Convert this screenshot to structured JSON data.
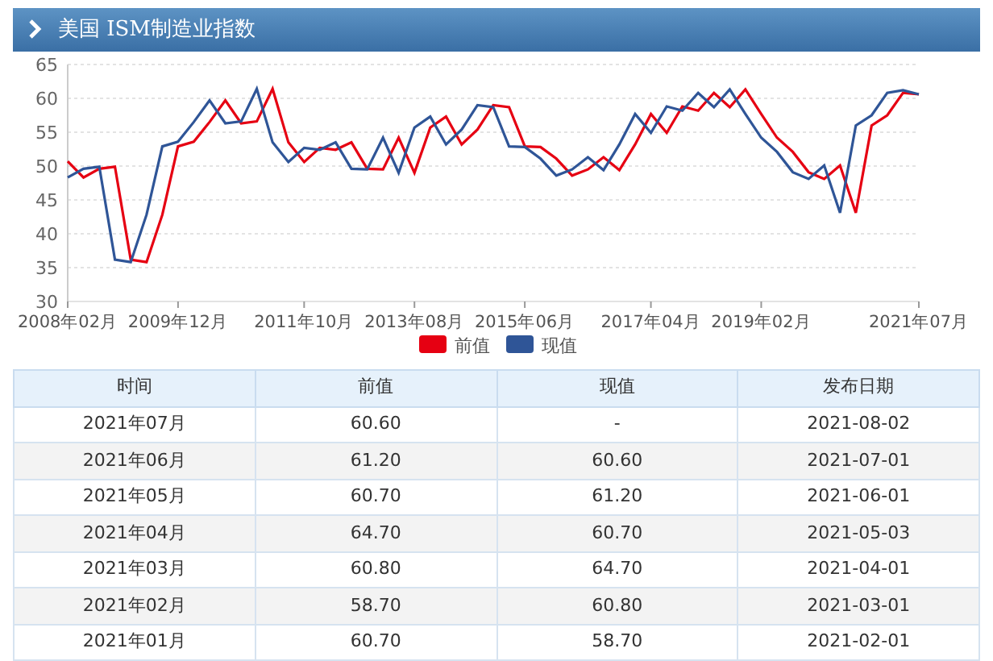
{
  "header": {
    "title": "美国 ISM制造业指数"
  },
  "chart": {
    "chart_data": {
      "type": "line",
      "categories": [
        "2008年02月",
        null,
        null,
        null,
        null,
        null,
        null,
        "2009年12月",
        null,
        null,
        null,
        null,
        null,
        null,
        null,
        "2011年10月",
        null,
        null,
        null,
        null,
        null,
        null,
        "2013年08月",
        null,
        null,
        null,
        null,
        null,
        null,
        "2015年06月",
        null,
        null,
        null,
        null,
        null,
        null,
        null,
        "2017年04月",
        null,
        null,
        null,
        null,
        null,
        null,
        "2019年02月",
        null,
        null,
        null,
        null,
        null,
        null,
        null,
        null,
        null,
        "2021年07月"
      ],
      "series": [
        {
          "name": "前值",
          "color": "#e60012",
          "values": [
            50.7,
            48.3,
            49.6,
            49.9,
            36.2,
            35.8,
            42.8,
            52.9,
            53.6,
            56.5,
            59.7,
            56.3,
            56.6,
            61.4,
            53.5,
            50.6,
            52.7,
            52.4,
            53.5,
            49.6,
            49.5,
            54.2,
            49.0,
            55.7,
            57.3,
            53.2,
            55.4,
            59.0,
            58.7,
            52.9,
            52.8,
            51.1,
            48.6,
            49.5,
            51.3,
            49.4,
            53.2,
            57.7,
            54.9,
            58.8,
            58.2,
            60.8,
            58.7,
            61.3,
            57.7,
            54.2,
            52.1,
            49.1,
            48.1,
            50.1,
            43.1,
            56.0,
            57.5,
            60.8,
            60.6
          ]
        },
        {
          "name": "现值",
          "color": "#2f5597",
          "values": [
            48.3,
            49.6,
            49.9,
            36.2,
            35.8,
            42.8,
            52.9,
            53.6,
            56.5,
            59.7,
            56.3,
            56.6,
            61.4,
            53.5,
            50.6,
            52.7,
            52.4,
            53.5,
            49.6,
            49.5,
            54.2,
            49.0,
            55.7,
            57.3,
            53.2,
            55.4,
            59.0,
            58.7,
            52.9,
            52.8,
            51.1,
            48.6,
            49.5,
            51.3,
            49.4,
            53.2,
            57.7,
            54.9,
            58.8,
            58.2,
            60.8,
            58.7,
            61.3,
            57.7,
            54.2,
            52.1,
            49.1,
            48.1,
            50.1,
            43.1,
            56.0,
            57.5,
            60.8,
            61.2,
            60.6
          ]
        }
      ],
      "grid": true,
      "legend": "bottom",
      "ylim": [
        30,
        65
      ],
      "yticks": [
        30,
        35,
        40,
        45,
        50,
        55,
        60,
        65
      ]
    }
  },
  "table": {
    "columns": [
      "时间",
      "前值",
      "现值",
      "发布日期"
    ],
    "rows": [
      [
        "2021年07月",
        "60.60",
        "-",
        "2021-08-02"
      ],
      [
        "2021年06月",
        "61.20",
        "60.60",
        "2021-07-01"
      ],
      [
        "2021年05月",
        "60.70",
        "61.20",
        "2021-06-01"
      ],
      [
        "2021年04月",
        "64.70",
        "60.70",
        "2021-05-03"
      ],
      [
        "2021年03月",
        "60.80",
        "64.70",
        "2021-04-01"
      ],
      [
        "2021年02月",
        "58.70",
        "60.80",
        "2021-03-01"
      ],
      [
        "2021年01月",
        "60.70",
        "58.70",
        "2021-02-01"
      ]
    ]
  }
}
